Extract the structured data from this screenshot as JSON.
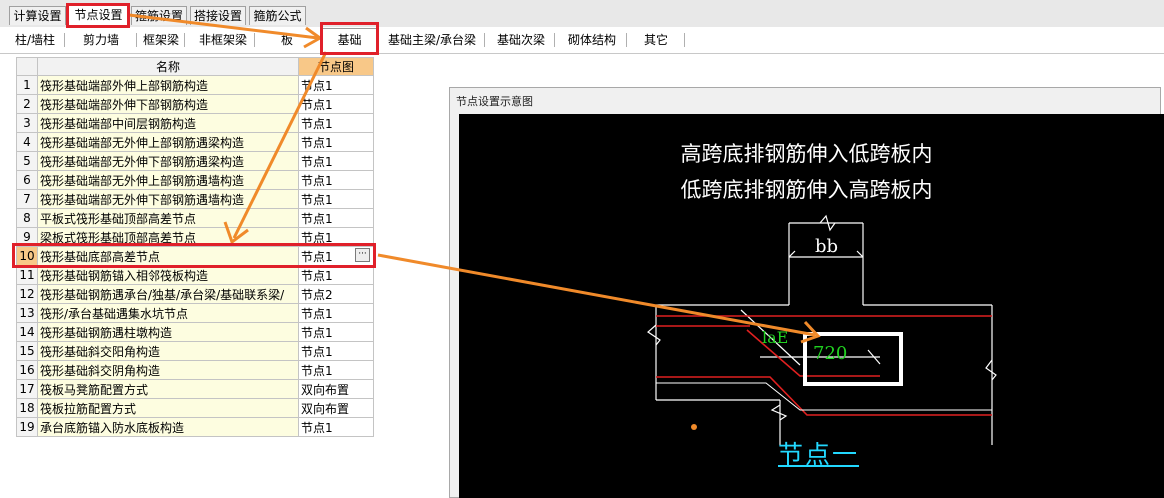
{
  "top_tabs": [
    "计算设置",
    "节点设置",
    "箍筋设置",
    "搭接设置",
    "箍筋公式"
  ],
  "sub_tabs": [
    "柱/墙柱",
    "剪力墙",
    "框架梁",
    "非框架梁",
    "板",
    "基础",
    "基础主梁/承台梁",
    "基础次梁",
    "砌体结构",
    "其它"
  ],
  "table": {
    "headers": [
      "名称",
      "节点图"
    ],
    "rows": [
      {
        "num": "1",
        "name": "筏形基础端部外伸上部钢筋构造",
        "value": "节点1"
      },
      {
        "num": "2",
        "name": "筏形基础端部外伸下部钢筋构造",
        "value": "节点1"
      },
      {
        "num": "3",
        "name": "筏形基础端部中间层钢筋构造",
        "value": "节点1"
      },
      {
        "num": "4",
        "name": "筏形基础端部无外伸上部钢筋遇梁构造",
        "value": "节点1"
      },
      {
        "num": "5",
        "name": "筏形基础端部无外伸下部钢筋遇梁构造",
        "value": "节点1"
      },
      {
        "num": "6",
        "name": "筏形基础端部无外伸上部钢筋遇墙构造",
        "value": "节点1"
      },
      {
        "num": "7",
        "name": "筏形基础端部无外伸下部钢筋遇墙构造",
        "value": "节点1"
      },
      {
        "num": "8",
        "name": "平板式筏形基础顶部高差节点",
        "value": "节点1"
      },
      {
        "num": "9",
        "name": "梁板式筏形基础顶部高差节点",
        "value": "节点1"
      },
      {
        "num": "10",
        "name": "筏形基础底部高差节点",
        "value": "节点1"
      },
      {
        "num": "11",
        "name": "筏形基础钢筋锚入相邻筏板构造",
        "value": "节点1"
      },
      {
        "num": "12",
        "name": "筏形基础钢筋遇承台/独基/承台梁/基础联系梁/",
        "value": "节点2"
      },
      {
        "num": "13",
        "name": "筏形/承台基础遇集水坑节点",
        "value": "节点1"
      },
      {
        "num": "14",
        "name": "筏形基础钢筋遇柱墩构造",
        "value": "节点1"
      },
      {
        "num": "15",
        "name": "筏形基础斜交阳角构造",
        "value": "节点1"
      },
      {
        "num": "16",
        "name": "筏形基础斜交阴角构造",
        "value": "节点1"
      },
      {
        "num": "17",
        "name": "筏板马凳筋配置方式",
        "value": "双向布置"
      },
      {
        "num": "18",
        "name": "筏板拉筋配置方式",
        "value": "双向布置"
      },
      {
        "num": "19",
        "name": "承台底筋锚入防水底板构造",
        "value": "节点1"
      }
    ],
    "selected_index": 9,
    "row10_button": "···"
  },
  "diagram": {
    "panel_title": "节点设置示意图",
    "line1": "高跨底排钢筋伸入低跨板内",
    "line2": "低跨底排钢筋伸入高跨板内",
    "dim_bb": "bb",
    "dim_lae": "laE",
    "dim_720": "720",
    "node_label": "节点一"
  },
  "colors": {
    "highlight_red": "#e0202a",
    "arrow_orange": "#f08a2a",
    "rebar_red": "#e02020",
    "dim_green": "#20d020",
    "label_cyan": "#22d8ff"
  }
}
